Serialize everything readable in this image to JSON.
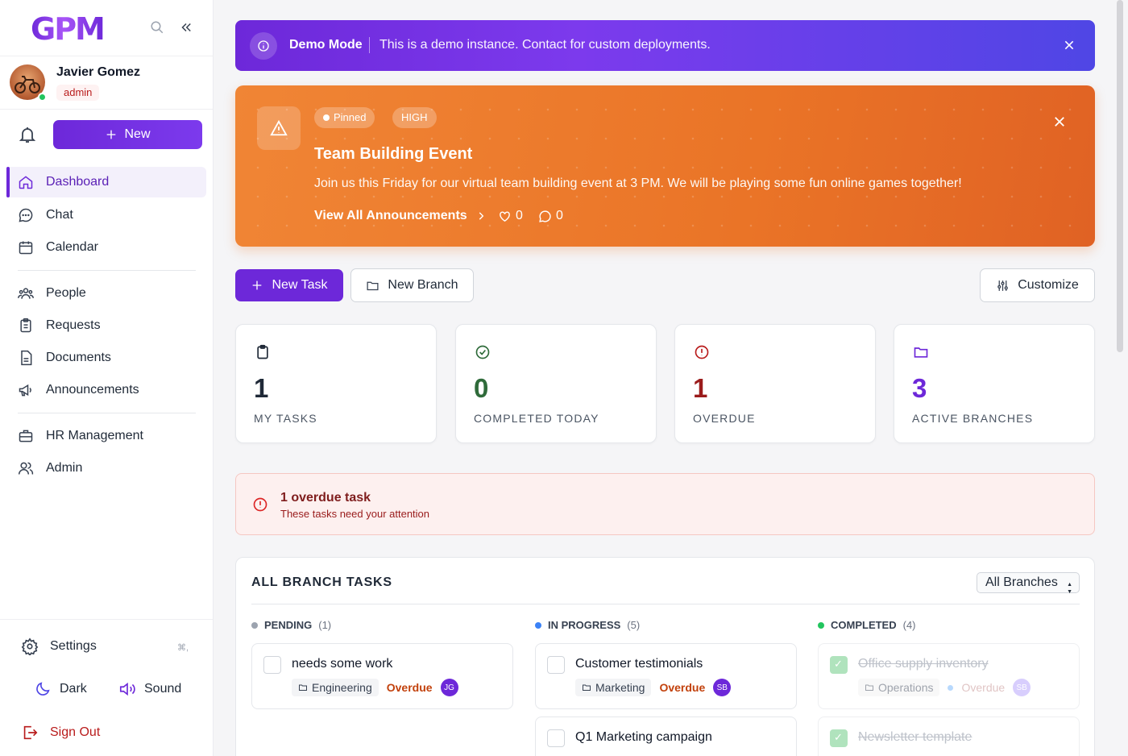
{
  "app": {
    "logo": "GPM"
  },
  "user": {
    "name": "Javier Gomez",
    "role": "admin"
  },
  "sidebar": {
    "new_label": "New",
    "items": [
      {
        "label": "Dashboard",
        "icon": "home-icon"
      },
      {
        "label": "Chat",
        "icon": "chat-icon"
      },
      {
        "label": "Calendar",
        "icon": "calendar-icon"
      },
      {
        "label": "People",
        "icon": "people-icon"
      },
      {
        "label": "Requests",
        "icon": "clipboard-icon"
      },
      {
        "label": "Documents",
        "icon": "document-icon"
      },
      {
        "label": "Announcements",
        "icon": "megaphone-icon"
      },
      {
        "label": "HR Management",
        "icon": "briefcase-icon"
      },
      {
        "label": "Admin",
        "icon": "admin-icon"
      }
    ],
    "settings_label": "Settings",
    "settings_shortcut": "⌘,",
    "dark_label": "Dark",
    "sound_label": "Sound",
    "signout_label": "Sign Out"
  },
  "demo": {
    "title": "Demo Mode",
    "text": "This is a demo instance. Contact for custom deployments."
  },
  "announcement": {
    "pinned": "Pinned",
    "priority": "HIGH",
    "title": "Team Building Event",
    "body": "Join us this Friday for our virtual team building event at 3 PM. We will be playing some fun online games together!",
    "link": "View All Announcements",
    "likes": "0",
    "comments": "0"
  },
  "actions": {
    "new_task": "New Task",
    "new_branch": "New Branch",
    "customize": "Customize"
  },
  "stats": [
    {
      "value": "1",
      "label": "MY TASKS",
      "color": "#1f2937"
    },
    {
      "value": "0",
      "label": "COMPLETED TODAY",
      "color": "#2f6b3a"
    },
    {
      "value": "1",
      "label": "OVERDUE",
      "color": "#9b1c1c"
    },
    {
      "value": "3",
      "label": "ACTIVE BRANCHES",
      "color": "#6d28d9"
    }
  ],
  "alert": {
    "title": "1 overdue task",
    "subtitle": "These tasks need your attention"
  },
  "tasks": {
    "title": "ALL BRANCH TASKS",
    "filter": "All Branches",
    "columns": [
      {
        "name": "PENDING",
        "count": "(1)",
        "color": "#9ca3af"
      },
      {
        "name": "IN PROGRESS",
        "count": "(5)",
        "color": "#3b82f6"
      },
      {
        "name": "COMPLETED",
        "count": "(4)",
        "color": "#22c55e"
      }
    ],
    "cards": [
      {
        "title": "needs some work",
        "branch": "Engineering",
        "status": "Overdue",
        "assignee": "JG"
      },
      {
        "title": "Customer testimonials",
        "branch": "Marketing",
        "status": "Overdue",
        "assignee": "SB"
      },
      {
        "title": "Q1 Marketing campaign"
      },
      {
        "title": "Office supply inventory",
        "branch": "Operations",
        "status": "Overdue",
        "assignee": "SB"
      },
      {
        "title": "Newsletter template"
      }
    ]
  }
}
